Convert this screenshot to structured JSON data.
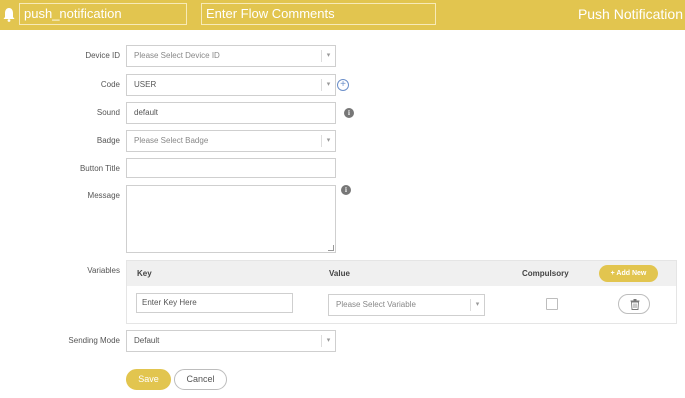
{
  "header": {
    "flow_name": "push_notification",
    "comments_placeholder": "Enter Flow Comments",
    "title": "Push Notification"
  },
  "form": {
    "device_id": {
      "label": "Device ID",
      "placeholder": "Please Select Device ID"
    },
    "code": {
      "label": "Code",
      "value": "USER"
    },
    "sound": {
      "label": "Sound",
      "value": "default"
    },
    "badge": {
      "label": "Badge",
      "placeholder": "Please Select Badge"
    },
    "button_title": {
      "label": "Button Title",
      "value": ""
    },
    "message": {
      "label": "Message",
      "value": ""
    },
    "variables": {
      "label": "Variables",
      "columns": [
        "Key",
        "Value",
        "Compulsory"
      ],
      "add_new_label": "+ Add New",
      "rows": [
        {
          "key_placeholder": "Enter Key Here",
          "value_placeholder": "Please Select Variable",
          "compulsory": false
        }
      ]
    },
    "sending_mode": {
      "label": "Sending Mode",
      "value": "Default"
    }
  },
  "actions": {
    "save_label": "Save",
    "cancel_label": "Cancel"
  },
  "colors": {
    "accent": "#e2c54f",
    "border": "#cfcfcf"
  }
}
